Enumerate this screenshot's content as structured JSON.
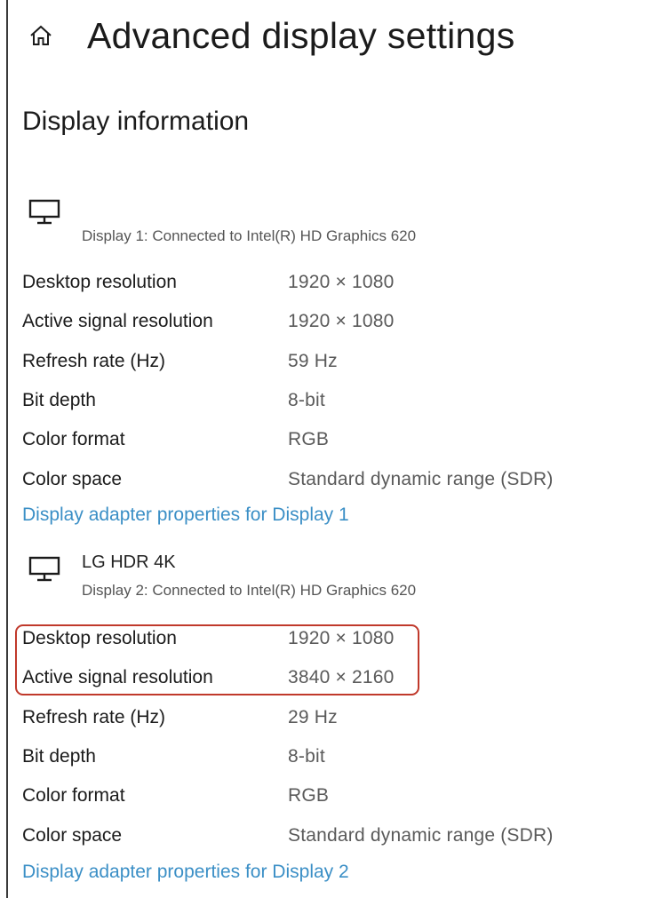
{
  "header": {
    "title": "Advanced display settings",
    "home_icon": "home-icon"
  },
  "section": {
    "title": "Display information"
  },
  "displays": [
    {
      "name": "",
      "subtitle": "Display 1: Connected to Intel(R) HD Graphics 620",
      "icon": "monitor-icon",
      "rows": [
        {
          "label": "Desktop resolution",
          "value": "1920 × 1080"
        },
        {
          "label": "Active signal resolution",
          "value": "1920 × 1080"
        },
        {
          "label": "Refresh rate (Hz)",
          "value": "59 Hz"
        },
        {
          "label": "Bit depth",
          "value": "8-bit"
        },
        {
          "label": "Color format",
          "value": "RGB"
        },
        {
          "label": "Color space",
          "value": "Standard dynamic range (SDR)"
        }
      ],
      "link": "Display adapter properties for Display 1"
    },
    {
      "name": "LG HDR 4K",
      "subtitle": "Display 2: Connected to Intel(R) HD Graphics 620",
      "icon": "monitor-icon",
      "rows": [
        {
          "label": "Desktop resolution",
          "value": "1920 × 1080"
        },
        {
          "label": "Active signal resolution",
          "value": "3840 × 2160"
        },
        {
          "label": "Refresh rate (Hz)",
          "value": "29 Hz"
        },
        {
          "label": "Bit depth",
          "value": "8-bit"
        },
        {
          "label": "Color format",
          "value": "RGB"
        },
        {
          "label": "Color space",
          "value": "Standard dynamic range (SDR)"
        }
      ],
      "link": "Display adapter properties for Display 2"
    }
  ],
  "colors": {
    "link": "#3b8fc6",
    "highlight": "#c0392b",
    "value_text": "#5a5a5a"
  }
}
